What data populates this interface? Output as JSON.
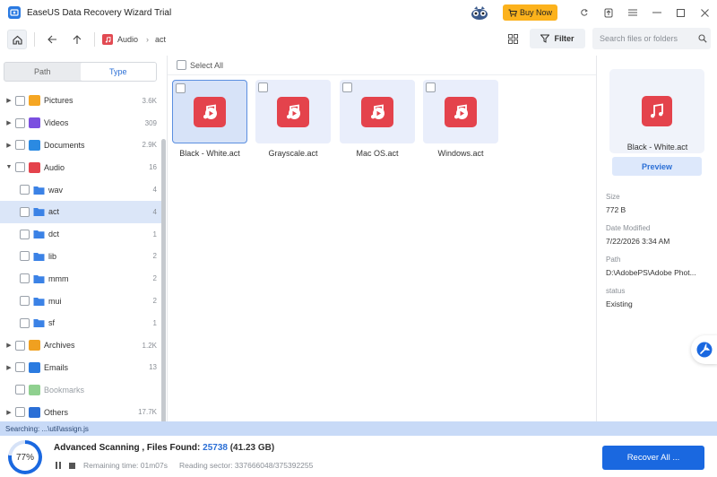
{
  "titlebar": {
    "title": "EaseUS Data Recovery Wizard Trial",
    "buy_label": "Buy Now",
    "icons": [
      "app-logo-icon",
      "mascot-icon",
      "cart-icon",
      "refresh-icon",
      "upload-icon",
      "menu-icon",
      "minimize-icon",
      "maximize-icon",
      "close-icon"
    ]
  },
  "toolbar": {
    "breadcrumb": [
      "Audio",
      "act"
    ],
    "filter_label": "Filter",
    "search_placeholder": "Search files or folders"
  },
  "left": {
    "tabs": [
      {
        "label": "Path",
        "active": false
      },
      {
        "label": "Type",
        "active": true
      }
    ],
    "tree": [
      {
        "label": "Pictures",
        "count": "3.6K",
        "expanded": false,
        "icon": "pictures-icon",
        "level": 0
      },
      {
        "label": "Videos",
        "count": "309",
        "expanded": false,
        "icon": "videos-icon",
        "level": 0
      },
      {
        "label": "Documents",
        "count": "2.9K",
        "expanded": false,
        "icon": "documents-icon",
        "level": 0
      },
      {
        "label": "Audio",
        "count": "16",
        "expanded": true,
        "icon": "audio-icon",
        "level": 0
      },
      {
        "label": "wav",
        "count": "4",
        "icon": "folder-icon",
        "level": 1
      },
      {
        "label": "act",
        "count": "4",
        "icon": "folder-icon",
        "level": 1,
        "selected": true
      },
      {
        "label": "dct",
        "count": "1",
        "icon": "folder-icon",
        "level": 1
      },
      {
        "label": "lib",
        "count": "2",
        "icon": "folder-icon",
        "level": 1
      },
      {
        "label": "mmm",
        "count": "2",
        "icon": "folder-icon",
        "level": 1
      },
      {
        "label": "mui",
        "count": "2",
        "icon": "folder-icon",
        "level": 1
      },
      {
        "label": "sf",
        "count": "1",
        "icon": "folder-icon",
        "level": 1
      },
      {
        "label": "Archives",
        "count": "1.2K",
        "expanded": false,
        "icon": "archives-icon",
        "level": 0
      },
      {
        "label": "Emails",
        "count": "13",
        "expanded": false,
        "icon": "emails-icon",
        "level": 0
      },
      {
        "label": "Bookmarks",
        "count": "",
        "icon": "bookmarks-icon",
        "level": 0,
        "muted": true
      },
      {
        "label": "Others",
        "count": "17.7K",
        "expanded": false,
        "icon": "others-icon",
        "level": 0
      }
    ]
  },
  "center": {
    "select_all_label": "Select All",
    "files": [
      {
        "name": "Black - White.act",
        "selected": true
      },
      {
        "name": "Grayscale.act",
        "selected": false
      },
      {
        "name": "Mac OS.act",
        "selected": false
      },
      {
        "name": "Windows.act",
        "selected": false
      }
    ]
  },
  "details": {
    "filename": "Black - White.act",
    "preview_label": "Preview",
    "size_label": "Size",
    "size_value": "772 B",
    "modified_label": "Date Modified",
    "modified_value": "7/22/2026 3:34 AM",
    "path_label": "Path",
    "path_value": "D:\\AdobePS\\Adobe Phot...",
    "status_label": "status",
    "status_value": "Existing"
  },
  "status": {
    "searching": "Searching: ...\\util\\assign.js"
  },
  "bottom": {
    "progress_percent": 77,
    "progress_label": "77%",
    "scan_title": "Advanced Scanning , Files Found: ",
    "files_found": "25738",
    "files_size": " (41.23 GB)",
    "remaining": "Remaining time: 01m07s",
    "sector": "Reading sector: 337666048/375392255",
    "recover_label": "Recover All ..."
  },
  "colors": {
    "accent": "#1a68e0",
    "selection": "#dbe6f8",
    "status_strip": "#c8daf7",
    "buy_button": "#fcb21c",
    "audio_red": "#e4434c"
  }
}
